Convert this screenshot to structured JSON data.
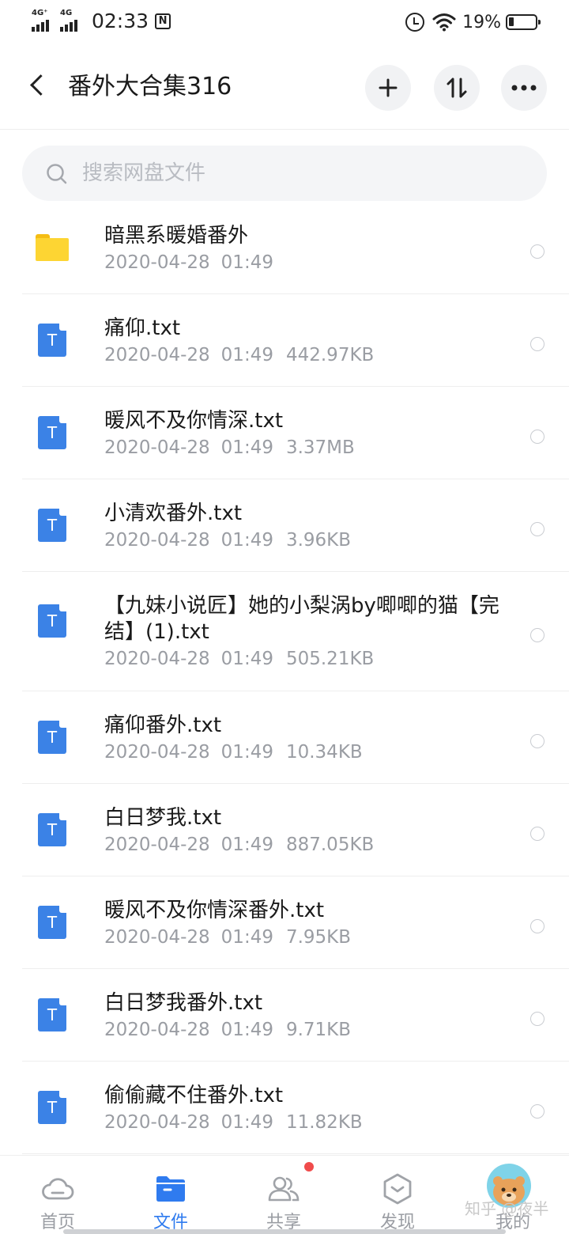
{
  "status_bar": {
    "network_1": "4G⁺",
    "network_2": "4G",
    "time": "02:33",
    "nfc": "N",
    "battery_percent": "19%"
  },
  "header": {
    "title": "番外大合集316",
    "back_icon": "chevron-left-icon",
    "actions": [
      "plus-icon",
      "sort-icon",
      "more-icon"
    ]
  },
  "search": {
    "placeholder": "搜索网盘文件"
  },
  "files": [
    {
      "type": "folder",
      "name": "暗黑系暖婚番外",
      "date": "2020-04-28",
      "time": "01:49",
      "size": ""
    },
    {
      "type": "txt",
      "name": "痛仰.txt",
      "date": "2020-04-28",
      "time": "01:49",
      "size": "442.97KB"
    },
    {
      "type": "txt",
      "name": "暖风不及你情深.txt",
      "date": "2020-04-28",
      "time": "01:49",
      "size": "3.37MB"
    },
    {
      "type": "txt",
      "name": "小清欢番外.txt",
      "date": "2020-04-28",
      "time": "01:49",
      "size": "3.96KB"
    },
    {
      "type": "txt",
      "name": "【九妹小说匠】她的小梨涡by唧唧的猫【完结】(1).txt",
      "date": "2020-04-28",
      "time": "01:49",
      "size": "505.21KB"
    },
    {
      "type": "txt",
      "name": "痛仰番外.txt",
      "date": "2020-04-28",
      "time": "01:49",
      "size": "10.34KB"
    },
    {
      "type": "txt",
      "name": "白日梦我.txt",
      "date": "2020-04-28",
      "time": "01:49",
      "size": "887.05KB"
    },
    {
      "type": "txt",
      "name": "暖风不及你情深番外.txt",
      "date": "2020-04-28",
      "time": "01:49",
      "size": "7.95KB"
    },
    {
      "type": "txt",
      "name": "白日梦我番外.txt",
      "date": "2020-04-28",
      "time": "01:49",
      "size": "9.71KB"
    },
    {
      "type": "txt",
      "name": "偷偷藏不住番外.txt",
      "date": "2020-04-28",
      "time": "01:49",
      "size": "11.82KB"
    }
  ],
  "file_icon_letter": "T",
  "nav": [
    {
      "label": "首页",
      "icon": "cloud-icon",
      "active": false
    },
    {
      "label": "文件",
      "icon": "folder-icon",
      "active": true
    },
    {
      "label": "共享",
      "icon": "users-icon",
      "active": false,
      "badge": true
    },
    {
      "label": "发现",
      "icon": "hexagon-icon",
      "active": false
    },
    {
      "label": "我的",
      "icon": "avatar",
      "active": false
    }
  ],
  "watermark": "知乎 @夜半",
  "colors": {
    "accent": "#2f7bef",
    "file_icon": "#3b82e6",
    "folder": "#fdd533",
    "badge": "#f04b4b",
    "meta_text": "#9a9da3"
  }
}
